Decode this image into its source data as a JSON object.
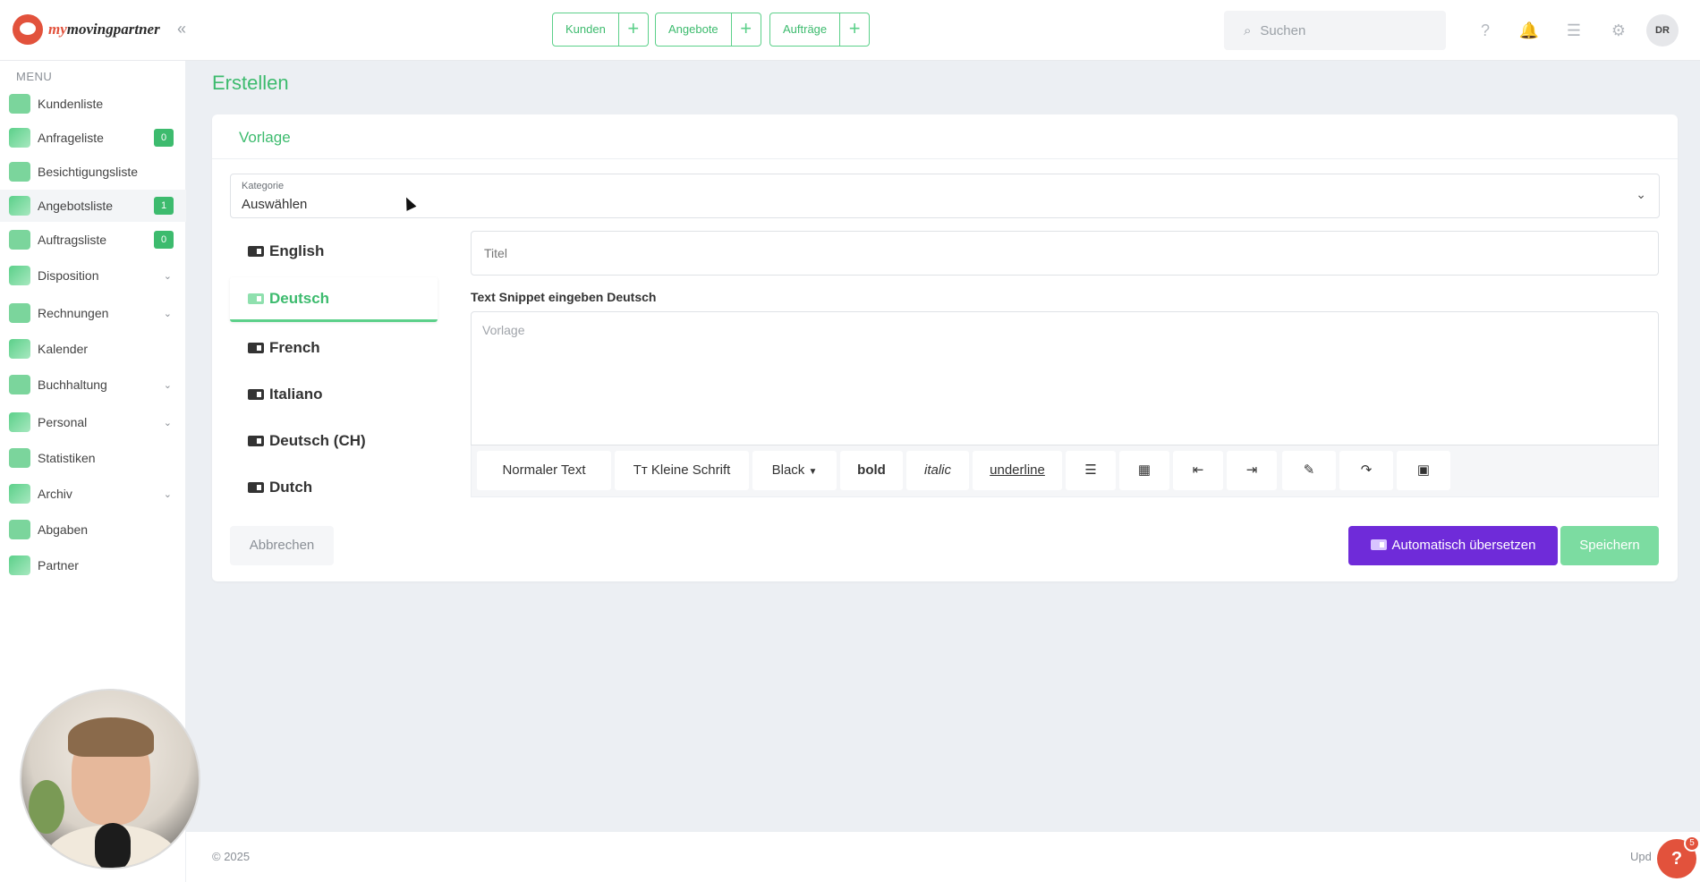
{
  "app": {
    "brand_prefix": "my",
    "brand_main": "movingpartner"
  },
  "header": {
    "quick": [
      {
        "label": "Kunden"
      },
      {
        "label": "Angebote"
      },
      {
        "label": "Aufträge"
      }
    ],
    "search_placeholder": "Suchen",
    "avatar": "DR",
    "icons": [
      "help-icon",
      "bell-icon",
      "checklist-icon",
      "gear-icon"
    ]
  },
  "sidebar": {
    "title": "MENU",
    "items": [
      {
        "label": "Kundenliste",
        "icon": "users-icon"
      },
      {
        "label": "Anfrageliste",
        "icon": "inbox-icon",
        "badge": "0"
      },
      {
        "label": "Besichtigungsliste",
        "icon": "house-icon"
      },
      {
        "label": "Angebotsliste",
        "icon": "offer-icon",
        "badge": "1"
      },
      {
        "label": "Auftragsliste",
        "icon": "order-icon",
        "badge": "0"
      },
      {
        "label": "Disposition",
        "icon": "disposition-icon"
      },
      {
        "label": "Rechnungen",
        "icon": "invoice-icon"
      },
      {
        "label": "Kalender",
        "icon": "calendar-icon"
      },
      {
        "label": "Buchhaltung",
        "icon": "accounting-icon"
      },
      {
        "label": "Personal",
        "icon": "staff-icon"
      },
      {
        "label": "Statistiken",
        "icon": "stats-icon"
      },
      {
        "label": "Archiv",
        "icon": "archive-icon"
      },
      {
        "label": "Abgaben",
        "icon": "network-icon"
      },
      {
        "label": "Partner",
        "icon": "handshake-icon"
      }
    ]
  },
  "main": {
    "page_title": "Erstellen",
    "card_title": "Vorlage",
    "category": {
      "label": "Kategorie",
      "value": "Auswählen"
    },
    "languages": [
      "English",
      "Deutsch",
      "French",
      "Italiano",
      "Deutsch (CH)",
      "Dutch"
    ],
    "active_language": "Deutsch",
    "title_placeholder": "Titel",
    "snippet_label": "Text Snippet eingeben Deutsch",
    "editor_placeholder": "Vorlage",
    "toolbar": {
      "normal": "Normaler Text",
      "small": "Kleine Schrift",
      "color": "Black",
      "bold": "bold",
      "italic": "italic",
      "underline": "underline"
    },
    "buttons": {
      "cancel": "Abbrechen",
      "translate": "Automatisch übersetzen",
      "save": "Speichern"
    }
  },
  "footer": {
    "copyright": "© 2025",
    "update": "Upd",
    "help_badge": "5",
    "help_label": "?"
  }
}
